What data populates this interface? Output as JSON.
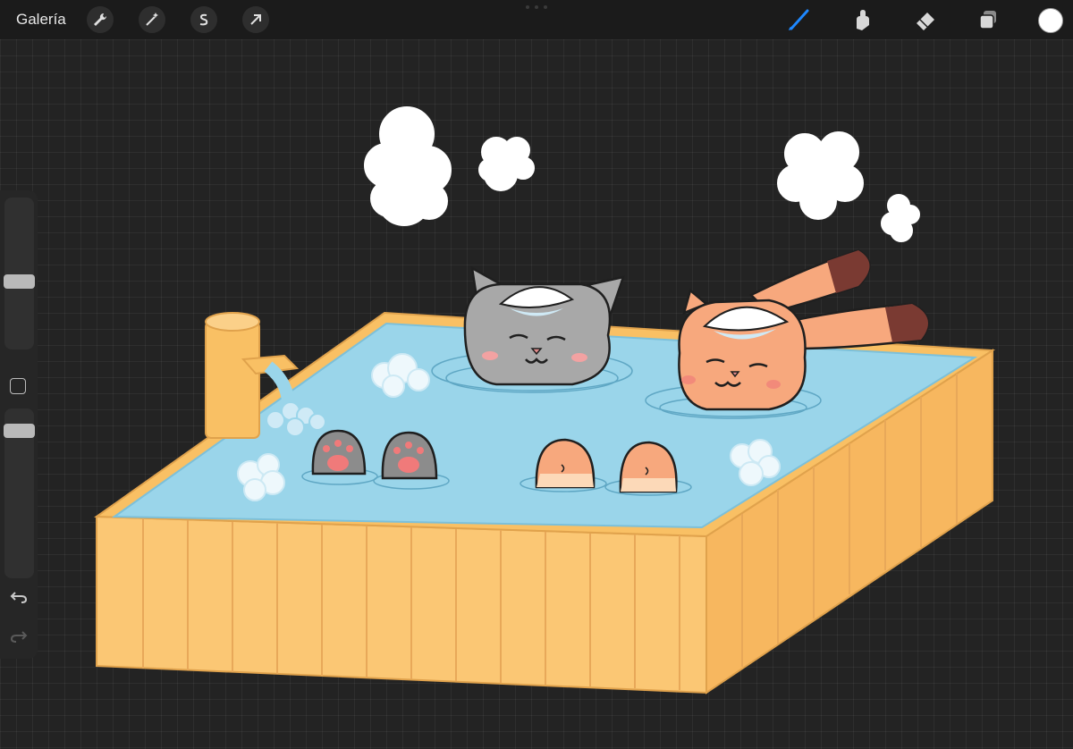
{
  "toolbar": {
    "gallery_label": "Galería",
    "left_tools": [
      "wrench-icon",
      "magic-wand-icon",
      "selection-s-icon",
      "arrow-cursor-icon"
    ],
    "right_tools": [
      "brush-icon",
      "smudge-icon",
      "eraser-icon",
      "layers-icon"
    ],
    "active_tool": "brush",
    "active_color": "#1e88ff",
    "current_color": "#ffffff"
  },
  "sidebar": {
    "brush_size_slider": "size-slider",
    "opacity_slider": "opacity-slider",
    "modifier_button": "square-icon",
    "undo": "undo-icon",
    "redo": "redo-icon"
  },
  "artwork": {
    "colors": {
      "wood": "#f9c46a",
      "wood_dark": "#e8a24b",
      "water": "#9ad5ea",
      "gray_cat": "#a8a8a8",
      "orange_cat": "#f7a87d",
      "ear_stripe": "#7a3a32",
      "steam": "#ffffff"
    }
  }
}
